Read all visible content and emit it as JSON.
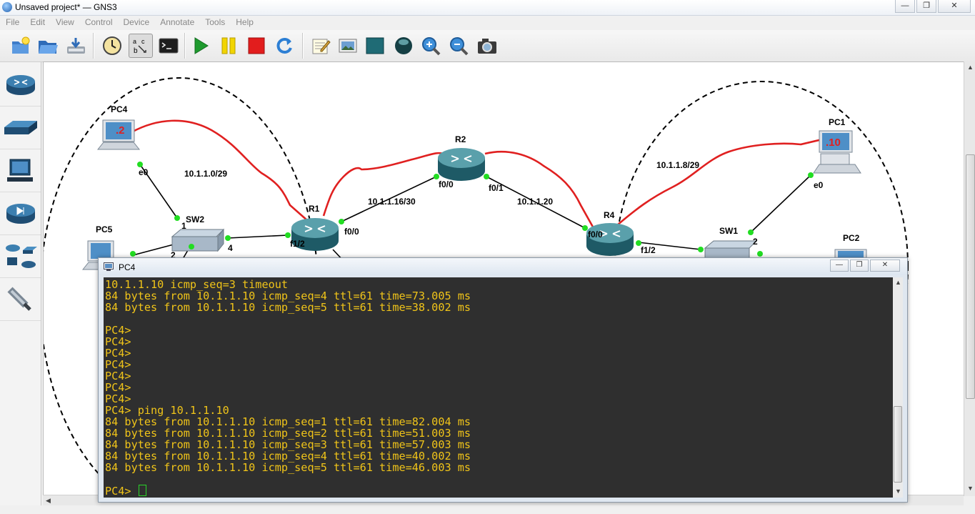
{
  "window": {
    "title": "Unsaved project* — GNS3"
  },
  "menu": [
    "File",
    "Edit",
    "View",
    "Control",
    "Device",
    "Annotate",
    "Tools",
    "Help"
  ],
  "toolbar": {
    "icons": [
      "new-project-icon",
      "open-project-icon",
      "save-project-icon",
      "snapshot-icon",
      "show-interface-labels-icon",
      "console-all-icon",
      "start-all-icon",
      "suspend-all-icon",
      "stop-all-icon",
      "reload-all-icon",
      "add-note-icon",
      "insert-picture-icon",
      "draw-rectangle-icon",
      "draw-ellipse-icon",
      "zoom-in-icon",
      "zoom-out-icon",
      "screenshot-icon"
    ]
  },
  "sidebar": {
    "icons": [
      "router-icon",
      "switch-icon",
      "end-device-icon",
      "security-device-icon",
      "all-devices-icon",
      "add-link-icon"
    ]
  },
  "topology": {
    "devices": {
      "pc4": "PC4",
      "pc5": "PC5",
      "sw2": "SW2",
      "r1": "R1",
      "r2": "R2",
      "r4": "R4",
      "sw1": "SW1",
      "pc1": "PC1",
      "pc2": "PC2"
    },
    "pc_screens": {
      "pc4": ".2",
      "pc1": ".10"
    },
    "ports": {
      "pc4_e0": "e0",
      "sw2_1": "1",
      "sw2_2": "2",
      "sw2_4": "4",
      "r1_f12": "f1/2",
      "r1_f00": "f0/0",
      "r2_f00": "f0/0",
      "r2_f01": "f0/1",
      "r4_f00": "f0/0",
      "r4_f12": "f1/2",
      "sw1_2": "2",
      "pc1_e0": "e0"
    },
    "subnets": {
      "left": "10.1.1.0/29",
      "r1_r2": "10.1.1.16/30",
      "r2_r4": "10.1.1.20",
      "right": "10.1.1.8/29"
    }
  },
  "console": {
    "title": "PC4",
    "lines": [
      "10.1.1.10 icmp_seq=3 timeout",
      "84 bytes from 10.1.1.10 icmp_seq=4 ttl=61 time=73.005 ms",
      "84 bytes from 10.1.1.10 icmp_seq=5 ttl=61 time=38.002 ms",
      "",
      "PC4>",
      "PC4>",
      "PC4>",
      "PC4>",
      "PC4>",
      "PC4>",
      "PC4>",
      "PC4> ping 10.1.1.10",
      "84 bytes from 10.1.1.10 icmp_seq=1 ttl=61 time=82.004 ms",
      "84 bytes from 10.1.1.10 icmp_seq=2 ttl=61 time=51.003 ms",
      "84 bytes from 10.1.1.10 icmp_seq=3 ttl=61 time=57.003 ms",
      "84 bytes from 10.1.1.10 icmp_seq=4 ttl=61 time=40.002 ms",
      "84 bytes from 10.1.1.10 icmp_seq=5 ttl=61 time=46.003 ms",
      ""
    ],
    "prompt": "PC4> "
  },
  "colors": {
    "terminal_bg": "#2f2f2f",
    "terminal_text": "#f0c419",
    "link_active": "#22dd22",
    "capture_line": "#e02020"
  }
}
